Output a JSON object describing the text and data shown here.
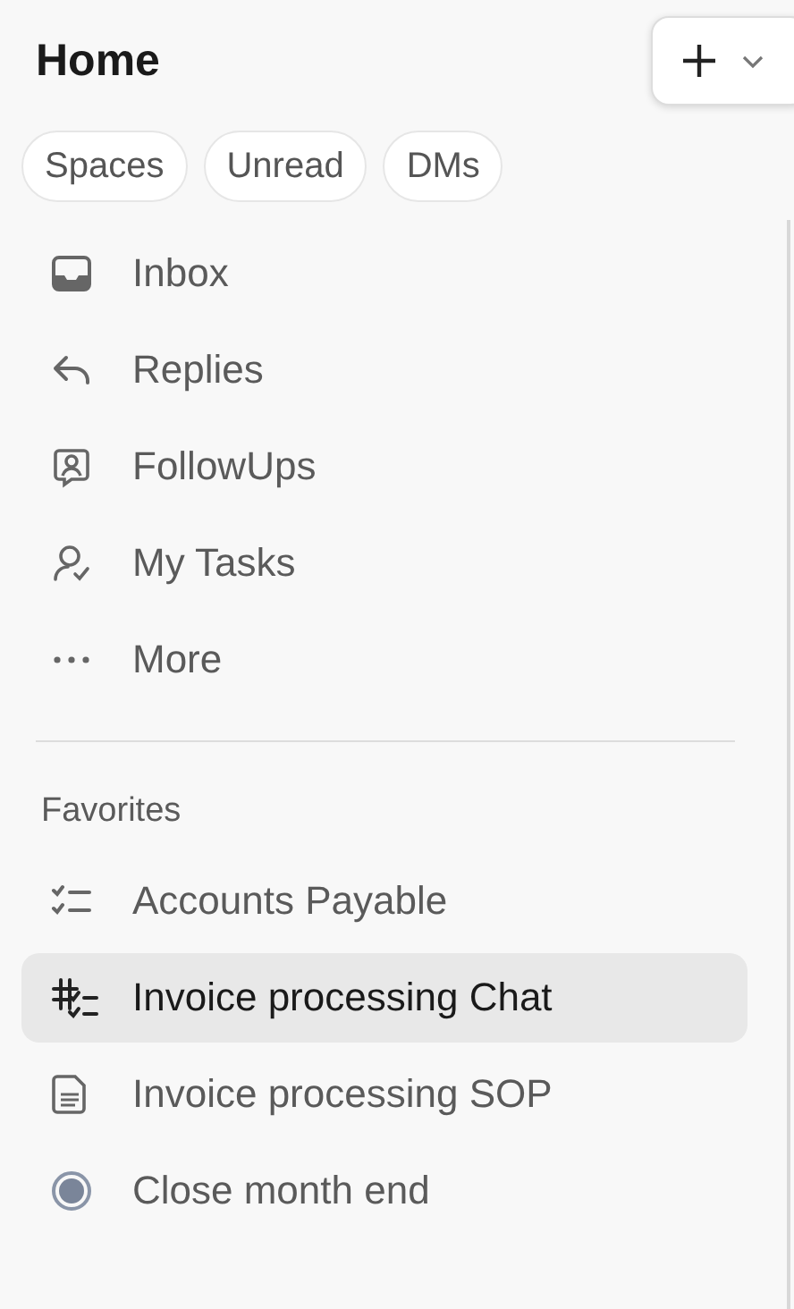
{
  "header": {
    "title": "Home"
  },
  "filters": [
    {
      "label": "Spaces",
      "selected": false
    },
    {
      "label": "Unread",
      "selected": false
    },
    {
      "label": "DMs",
      "selected": false
    }
  ],
  "nav": [
    {
      "label": "Inbox",
      "kind": "inbox",
      "selected": false
    },
    {
      "label": "Replies",
      "kind": "replies",
      "selected": false
    },
    {
      "label": "FollowUps",
      "kind": "followups",
      "selected": false
    },
    {
      "label": "My Tasks",
      "kind": "tasks",
      "selected": false
    },
    {
      "label": "More",
      "kind": "more",
      "selected": false
    }
  ],
  "favorites": {
    "title": "Favorites",
    "items": [
      {
        "label": "Accounts Payable",
        "kind": "checklist",
        "selected": false
      },
      {
        "label": "Invoice processing Chat",
        "kind": "channel",
        "selected": true
      },
      {
        "label": "Invoice processing SOP",
        "kind": "doc",
        "selected": false
      },
      {
        "label": "Close month end",
        "kind": "status",
        "selected": false
      }
    ]
  }
}
